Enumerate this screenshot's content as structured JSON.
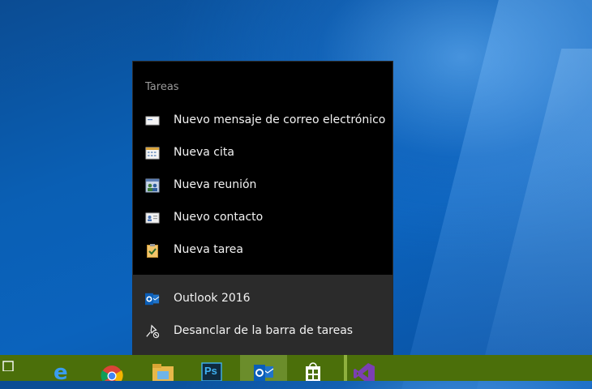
{
  "jumplist": {
    "header": "Tareas",
    "tasks": [
      {
        "label": "Nuevo mensaje de correo electrónico",
        "icon": "new-email-icon"
      },
      {
        "label": "Nueva cita",
        "icon": "calendar-icon"
      },
      {
        "label": "Nueva reunión",
        "icon": "meeting-icon"
      },
      {
        "label": "Nuevo contacto",
        "icon": "contact-card-icon"
      },
      {
        "label": "Nueva tarea",
        "icon": "task-clipboard-icon"
      }
    ],
    "pinned": [
      {
        "label": "Outlook 2016",
        "icon": "outlook-icon"
      },
      {
        "label": "Desanclar de la barra de tareas",
        "icon": "unpin-icon"
      }
    ]
  },
  "taskbar": {
    "apps": [
      {
        "name": "task-view",
        "icon": "task-view-icon"
      },
      {
        "name": "edge",
        "icon": "edge-icon"
      },
      {
        "name": "chrome",
        "icon": "chrome-icon"
      },
      {
        "name": "file-explorer",
        "icon": "folder-icon"
      },
      {
        "name": "photoshop",
        "icon": "photoshop-icon",
        "text": "Ps"
      },
      {
        "name": "outlook",
        "icon": "outlook-icon",
        "active": true
      },
      {
        "name": "store",
        "icon": "store-icon"
      },
      {
        "name": "visual-studio",
        "icon": "visual-studio-icon"
      }
    ]
  },
  "colors": {
    "taskbar": "#4b6f0a",
    "taskbar_active": "#6b8d2b",
    "menu_bg": "#000000",
    "menu_bottom_bg": "#2b2b2b",
    "desktop": "#0b63bd"
  }
}
